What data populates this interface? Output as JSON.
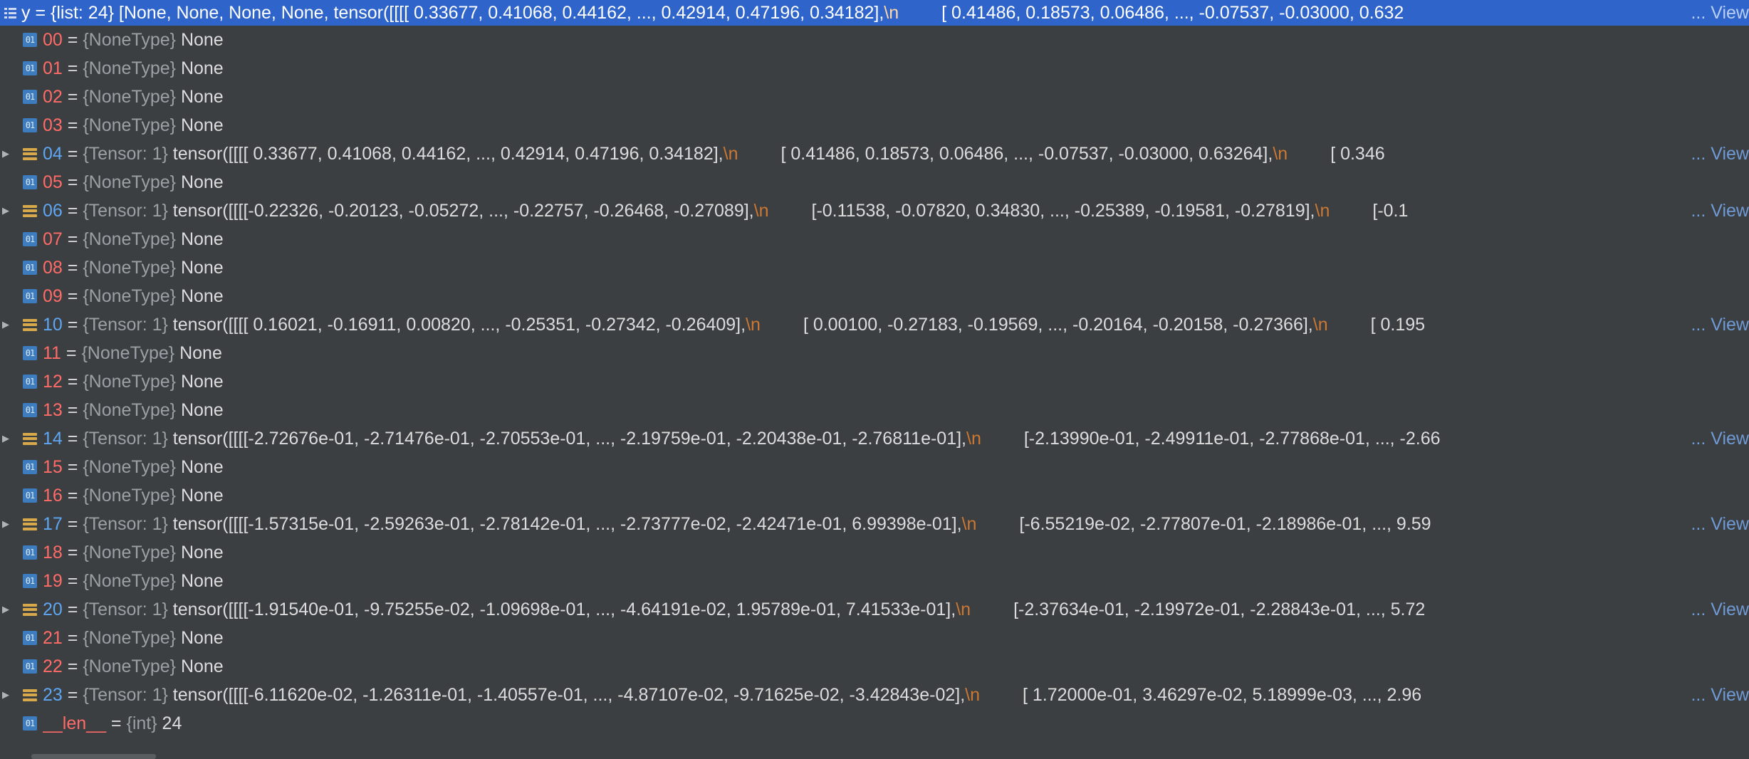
{
  "root": {
    "text": "y = {list: 24} [None, None, None, None, tensor([[[[ 0.33677,  0.41068,  0.44162,  ...,  0.42914,  0.47196,  0.34182],",
    "nl": "\\n",
    "cont": "[ 0.41486,  0.18573,  0.06486,  ..., -0.07537, -0.03000,  0.632"
  },
  "view_label": "... View",
  "rows": [
    {
      "name": "00",
      "type": "{NoneType}",
      "value": "None",
      "kind": "none"
    },
    {
      "name": "01",
      "type": "{NoneType}",
      "value": "None",
      "kind": "none"
    },
    {
      "name": "02",
      "type": "{NoneType}",
      "value": "None",
      "kind": "none"
    },
    {
      "name": "03",
      "type": "{NoneType}",
      "value": "None",
      "kind": "none"
    },
    {
      "name": "04",
      "type": "{Tensor: 1}",
      "value": "tensor([[[[ 0.33677,  0.41068,  0.44162,  ...,  0.42914,  0.47196,  0.34182],",
      "nl": "\\n",
      "cont": "[ 0.41486,  0.18573,  0.06486,  ..., -0.07537, -0.03000,  0.63264],",
      "nl2": "\\n",
      "cont2": "[ 0.346",
      "kind": "tensor"
    },
    {
      "name": "05",
      "type": "{NoneType}",
      "value": "None",
      "kind": "none"
    },
    {
      "name": "06",
      "type": "{Tensor: 1}",
      "value": "tensor([[[[-0.22326, -0.20123, -0.05272,  ..., -0.22757, -0.26468, -0.27089],",
      "nl": "\\n",
      "cont": "[-0.11538, -0.07820,  0.34830,  ..., -0.25389, -0.19581, -0.27819],",
      "nl2": "\\n",
      "cont2": "[-0.1",
      "kind": "tensor"
    },
    {
      "name": "07",
      "type": "{NoneType}",
      "value": "None",
      "kind": "none"
    },
    {
      "name": "08",
      "type": "{NoneType}",
      "value": "None",
      "kind": "none"
    },
    {
      "name": "09",
      "type": "{NoneType}",
      "value": "None",
      "kind": "none"
    },
    {
      "name": "10",
      "type": "{Tensor: 1}",
      "value": "tensor([[[[ 0.16021, -0.16911,  0.00820,  ..., -0.25351, -0.27342, -0.26409],",
      "nl": "\\n",
      "cont": "[ 0.00100, -0.27183, -0.19569,  ..., -0.20164, -0.20158, -0.27366],",
      "nl2": "\\n",
      "cont2": "[ 0.195",
      "kind": "tensor"
    },
    {
      "name": "11",
      "type": "{NoneType}",
      "value": "None",
      "kind": "none"
    },
    {
      "name": "12",
      "type": "{NoneType}",
      "value": "None",
      "kind": "none"
    },
    {
      "name": "13",
      "type": "{NoneType}",
      "value": "None",
      "kind": "none"
    },
    {
      "name": "14",
      "type": "{Tensor: 1}",
      "value": "tensor([[[[-2.72676e-01, -2.71476e-01, -2.70553e-01,  ..., -2.19759e-01, -2.20438e-01, -2.76811e-01],",
      "nl": "\\n",
      "cont": "[-2.13990e-01, -2.49911e-01, -2.77868e-01,  ..., -2.66",
      "nl2": "",
      "cont2": "",
      "kind": "tensor"
    },
    {
      "name": "15",
      "type": "{NoneType}",
      "value": "None",
      "kind": "none"
    },
    {
      "name": "16",
      "type": "{NoneType}",
      "value": "None",
      "kind": "none"
    },
    {
      "name": "17",
      "type": "{Tensor: 1}",
      "value": "tensor([[[[-1.57315e-01, -2.59263e-01, -2.78142e-01,  ..., -2.73777e-02, -2.42471e-01,  6.99398e-01],",
      "nl": "\\n",
      "cont": "[-6.55219e-02, -2.77807e-01, -2.18986e-01,  ...,  9.59",
      "nl2": "",
      "cont2": "",
      "kind": "tensor"
    },
    {
      "name": "18",
      "type": "{NoneType}",
      "value": "None",
      "kind": "none"
    },
    {
      "name": "19",
      "type": "{NoneType}",
      "value": "None",
      "kind": "none"
    },
    {
      "name": "20",
      "type": "{Tensor: 1}",
      "value": "tensor([[[[-1.91540e-01, -9.75255e-02, -1.09698e-01,  ..., -4.64191e-02,  1.95789e-01,  7.41533e-01],",
      "nl": "\\n",
      "cont": "[-2.37634e-01, -2.19972e-01, -2.28843e-01,  ...,  5.72",
      "nl2": "",
      "cont2": "",
      "kind": "tensor"
    },
    {
      "name": "21",
      "type": "{NoneType}",
      "value": "None",
      "kind": "none"
    },
    {
      "name": "22",
      "type": "{NoneType}",
      "value": "None",
      "kind": "none"
    },
    {
      "name": "23",
      "type": "{Tensor: 1}",
      "value": "tensor([[[[-6.11620e-02, -1.26311e-01, -1.40557e-01,  ..., -4.87107e-02, -9.71625e-02, -3.42843e-02],",
      "nl": "\\n",
      "cont": "[ 1.72000e-01,  3.46297e-02,  5.18999e-03,  ...,  2.96",
      "nl2": "",
      "cont2": "",
      "kind": "tensor"
    },
    {
      "name": "__len__",
      "type": "{int}",
      "value": "24",
      "kind": "int"
    }
  ],
  "icons": {
    "primitive_glyph": "01",
    "list": "list-icon",
    "expand": "expand-arrow-icon"
  },
  "colors": {
    "selection": "#2f65ca",
    "background": "#3c3f41",
    "none_name": "#ff6b68",
    "tensor_name": "#5ea6f2",
    "newline": "#cc7832",
    "view_link": "#6e9ad6"
  }
}
